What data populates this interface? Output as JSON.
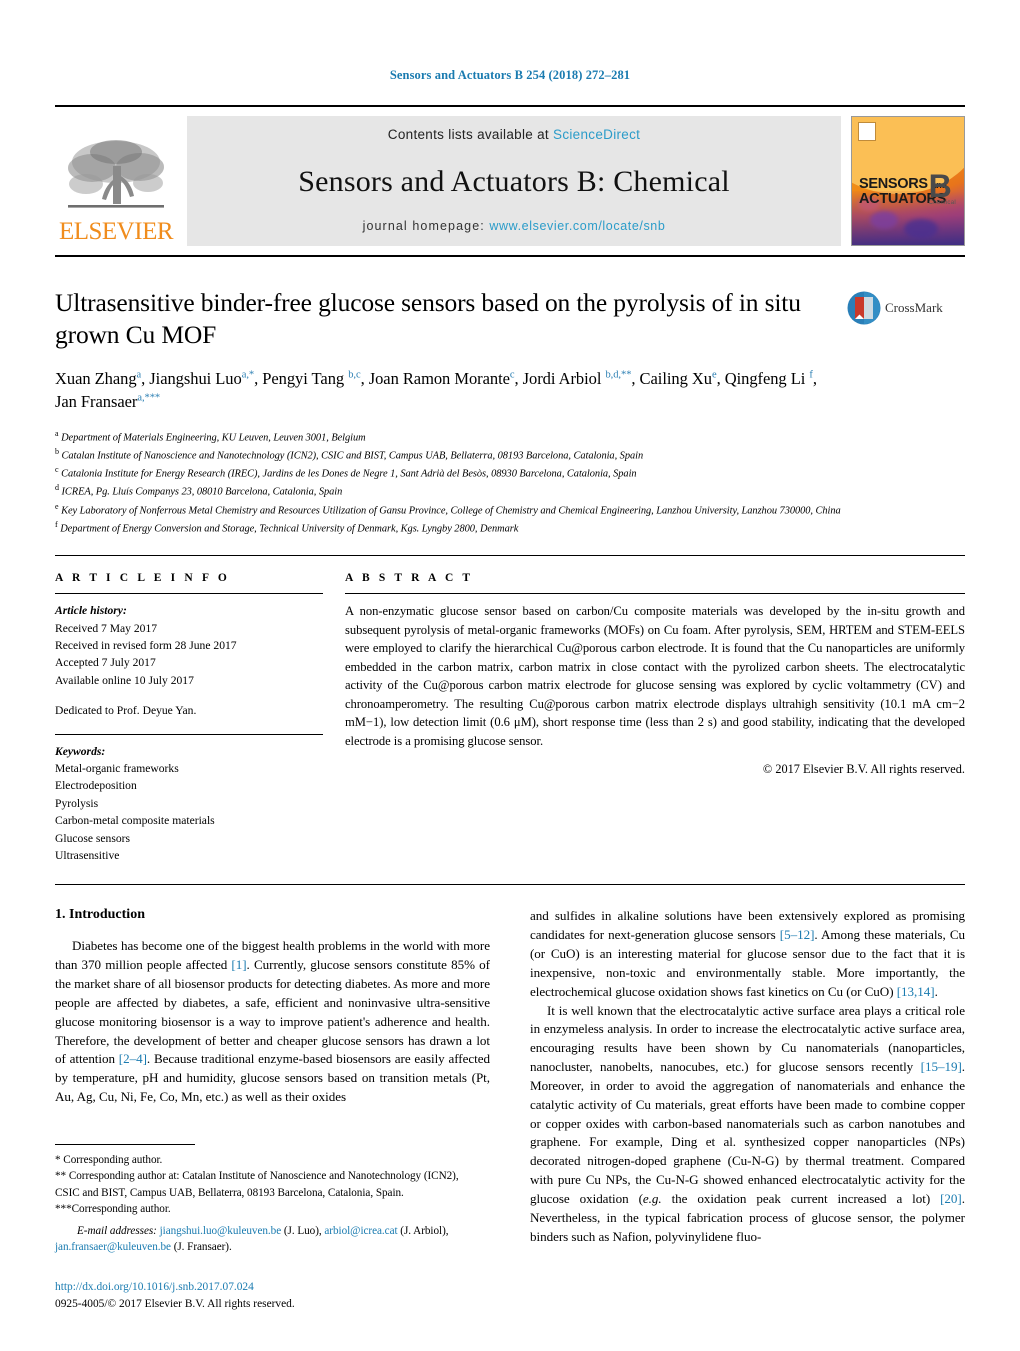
{
  "running_head": "Sensors and Actuators B 254 (2018) 272–281",
  "masthead": {
    "publisher": "ELSEVIER",
    "contents_prefix": "Contents lists available at ",
    "contents_link": "ScienceDirect",
    "journal_title": "Sensors and Actuators B: Chemical",
    "homepage_prefix": "journal homepage: ",
    "homepage_url": "www.elsevier.com/locate/snb",
    "cover": {
      "line1": "SENSORS",
      "line1_small": "and",
      "line2": "ACTUATORS",
      "letter": "B",
      "letter_sub": "Chemical"
    }
  },
  "article": {
    "title": "Ultrasensitive binder-free glucose sensors based on the pyrolysis of in situ grown Cu MOF",
    "crossmark_label": "CrossMark",
    "authors_html": "Xuan Zhang<sup>a</sup>, Jiangshui Luo<sup>a,<span class=\"star\">*</span></sup>, Pengyi Tang <sup>b,c</sup>, Joan Ramon Morante<sup>c</sup>, Jordi Arbiol <sup>b,d,<span class=\"star\">**</span></sup>, Cailing Xu<sup>e</sup>, Qingfeng Li <sup>f</sup>, Jan Fransaer<sup>a,<span class=\"star\">***</span></sup>",
    "affiliations": [
      {
        "mark": "a",
        "text": "Department of Materials Engineering, KU Leuven, Leuven 3001, Belgium"
      },
      {
        "mark": "b",
        "text": "Catalan Institute of Nanoscience and Nanotechnology (ICN2), CSIC and BIST, Campus UAB, Bellaterra, 08193 Barcelona, Catalonia, Spain"
      },
      {
        "mark": "c",
        "text": "Catalonia Institute for Energy Research (IREC), Jardins de les Dones de Negre 1, Sant Adrià del Besòs, 08930 Barcelona, Catalonia, Spain"
      },
      {
        "mark": "d",
        "text": "ICREA, Pg. Lluís Companys 23, 08010 Barcelona, Catalonia, Spain"
      },
      {
        "mark": "e",
        "text": "Key Laboratory of Nonferrous Metal Chemistry and Resources Utilization of Gansu Province, College of Chemistry and Chemical Engineering, Lanzhou University, Lanzhou 730000, China"
      },
      {
        "mark": "f",
        "text": "Department of Energy Conversion and Storage, Technical University of Denmark, Kgs. Lyngby 2800, Denmark"
      }
    ]
  },
  "article_info": {
    "heading": "A R T I C L E   I N F O",
    "history_label": "Article history:",
    "history": [
      "Received 7 May 2017",
      "Received in revised form 28 June 2017",
      "Accepted 7 July 2017",
      "Available online 10 July 2017"
    ],
    "dedication": "Dedicated to Prof. Deyue Yan.",
    "keywords_label": "Keywords:",
    "keywords": [
      "Metal-organic frameworks",
      "Electrodeposition",
      "Pyrolysis",
      "Carbon-metal composite materials",
      "Glucose sensors",
      "Ultrasensitive"
    ]
  },
  "abstract": {
    "heading": "A B S T R A C T",
    "text": "A non-enzymatic glucose sensor based on carbon/Cu composite materials was developed by the in-situ growth and subsequent pyrolysis of metal-organic frameworks (MOFs) on Cu foam. After pyrolysis, SEM, HRTEM and STEM-EELS were employed to clarify the hierarchical Cu@porous carbon electrode. It is found that the Cu nanoparticles are uniformly embedded in the carbon matrix, carbon matrix in close contact with the pyrolized carbon sheets. The electrocatalytic activity of the Cu@porous carbon matrix electrode for glucose sensing was explored by cyclic voltammetry (CV) and chronoamperometry. The resulting Cu@porous carbon matrix electrode displays ultrahigh sensitivity (10.1 mA cm−2 mM−1), low detection limit (0.6 μM), short response time (less than 2 s) and good stability, indicating that the developed electrode is a promising glucose sensor.",
    "copyright": "© 2017 Elsevier B.V. All rights reserved."
  },
  "introduction": {
    "heading": "1.  Introduction",
    "left_paragraph_html": "Diabetes has become one of the biggest health problems in the world with more than 370 million people affected <span class=\"ref\">[1]</span>. Currently, glucose sensors constitute 85% of the market share of all biosensor products for detecting diabetes. As more and more people are affected by diabetes, a safe, efficient and noninvasive ultra-sensitive glucose monitoring biosensor is a way to improve patient's adherence and health. Therefore, the development of better and cheaper glucose sensors has drawn a lot of attention <span class=\"ref\">[2–4]</span>. Because traditional enzyme-based biosensors are easily affected by temperature, pH and humidity, glucose sensors based on transition metals (Pt, Au, Ag, Cu, Ni, Fe, Co, Mn, etc.) as well as their oxides",
    "right_paragraph_1_html": "and sulfides in alkaline solutions have been extensively explored as promising candidates for next-generation glucose sensors <span class=\"ref\">[5–12]</span>. Among these materials, Cu (or CuO) is an interesting material for glucose sensor due to the fact that it is inexpensive, non-toxic and environmentally stable. More importantly, the electrochemical glucose oxidation shows fast kinetics on Cu (or CuO) <span class=\"ref\">[13,14]</span>.",
    "right_paragraph_2_html": "It is well known that the electrocatalytic active surface area plays a critical role in enzymeless analysis. In order to increase the electrocatalytic active surface area, encouraging results have been shown by Cu nanomaterials (nanoparticles, nanocluster, nanobelts, nanocubes, etc.) for glucose sensors recently <span class=\"ref\">[15–19]</span>. Moreover, in order to avoid the aggregation of nanomaterials and enhance the catalytic activity of Cu materials, great efforts have been made to combine copper or copper oxides with carbon-based nanomaterials such as carbon nanotubes and graphene. For example, Ding et al. synthesized copper nanoparticles (NPs) decorated nitrogen-doped graphene (Cu-N-G) by thermal treatment. Compared with pure Cu NPs, the Cu-N-G showed enhanced electrocatalytic activity for the glucose oxidation (<i>e.g.</i> the oxidation peak current increased a lot) <span class=\"ref\">[20]</span>. Nevertheless, in the typical fabrication process of glucose sensor, the polymer binders such as Nafion, polyvinylidene fluo-"
  },
  "footnotes": {
    "line1": "*  Corresponding author.",
    "line2": "**  Corresponding author at: Catalan Institute of Nanoscience and Nanotechnology (ICN2), CSIC and BIST, Campus UAB, Bellaterra, 08193 Barcelona, Catalonia, Spain.",
    "line3": "***Corresponding author.",
    "emails_label": "E-mail addresses:",
    "emails_html": " <span class=\"link\">jiangshui.luo@kuleuven.be</span> (J. Luo), <span class=\"link\">arbiol@icrea.cat</span> (J. Arbiol), <span class=\"link\">jan.fransaer@kuleuven.be</span> (J. Fransaer).",
    "doi": "http://dx.doi.org/10.1016/j.snb.2017.07.024",
    "issn_line": "0925-4005/© 2017 Elsevier B.V. All rights reserved."
  }
}
